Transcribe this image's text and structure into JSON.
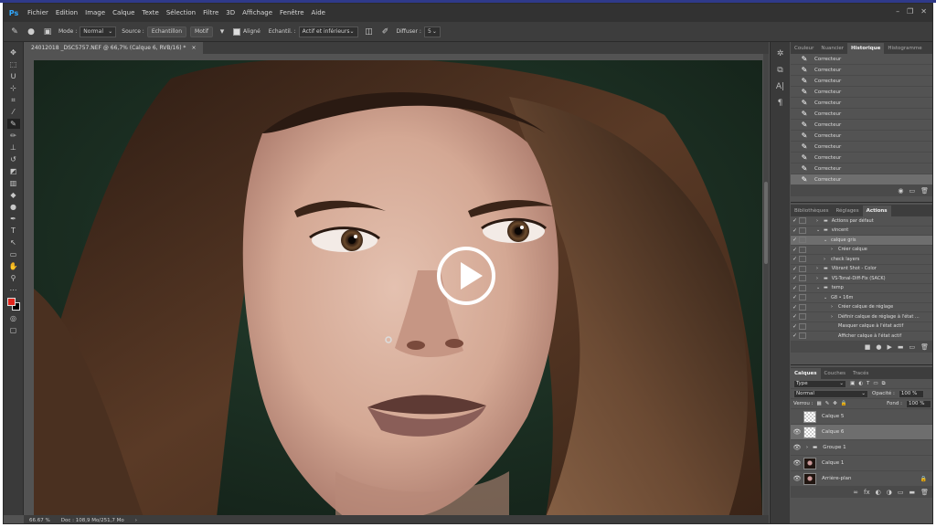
{
  "menubar": {
    "logo": "Ps",
    "items": [
      "Fichier",
      "Edition",
      "Image",
      "Calque",
      "Texte",
      "Sélection",
      "Filtre",
      "3D",
      "Affichage",
      "Fenêtre",
      "Aide"
    ],
    "window_controls": [
      "–",
      "❐",
      "✕"
    ]
  },
  "options": {
    "mode_label": "Mode :",
    "mode_value": "Normal",
    "source_label": "Source :",
    "sample_btn": "Echantillon",
    "pattern_btn": "Motif",
    "aligned_label": "Aligné",
    "sample_label": "Echantil. :",
    "sample_value": "Actif et inférieurs",
    "diffuse_label": "Diffuser :",
    "diffuse_value": "5"
  },
  "document": {
    "tab_title": "24012018 _DSC5757.NEF @ 66,7% (Calque 6, RVB/16) *",
    "tab_close": "×"
  },
  "status": {
    "zoom": "66.67 %",
    "doc_info": "Doc : 108,9 Mo/251,7 Mo"
  },
  "history_panel": {
    "tabs": [
      "Couleur",
      "Nuancier",
      "Historique",
      "Histogramme"
    ],
    "active_tab": "Historique",
    "entries": [
      "Correcteur",
      "Correcteur",
      "Correcteur",
      "Correcteur",
      "Correcteur",
      "Correcteur",
      "Correcteur",
      "Correcteur",
      "Correcteur",
      "Correcteur",
      "Correcteur",
      "Correcteur"
    ],
    "selected_index": 11
  },
  "actions_panel": {
    "tabs": [
      "Bibliothèques",
      "Réglages",
      "Actions"
    ],
    "active_tab": "Actions",
    "rows": [
      {
        "indent": 1,
        "arrow": "›",
        "folder": true,
        "label": "Actions par défaut",
        "sel": false
      },
      {
        "indent": 1,
        "arrow": "⌄",
        "folder": true,
        "label": "vincent",
        "sel": false
      },
      {
        "indent": 2,
        "arrow": "⌄",
        "folder": false,
        "label": "calque gris",
        "sel": true
      },
      {
        "indent": 3,
        "arrow": "›",
        "folder": false,
        "label": "Créer calque",
        "sel": false
      },
      {
        "indent": 2,
        "arrow": "›",
        "folder": false,
        "label": "check layers",
        "sel": false
      },
      {
        "indent": 1,
        "arrow": "›",
        "folder": true,
        "label": "Vibrant Shot - Color",
        "sel": false
      },
      {
        "indent": 1,
        "arrow": "›",
        "folder": true,
        "label": "VS-Tonal-Diff-Fix (SACK)",
        "sel": false
      },
      {
        "indent": 1,
        "arrow": "⌄",
        "folder": true,
        "label": "temp",
        "sel": false
      },
      {
        "indent": 2,
        "arrow": "⌄",
        "folder": false,
        "label": "G8 • 16m",
        "sel": false
      },
      {
        "indent": 3,
        "arrow": "›",
        "folder": false,
        "label": "Créer calque de réglage",
        "sel": false
      },
      {
        "indent": 3,
        "arrow": "›",
        "folder": false,
        "label": "Définir calque de réglage à l'état ...",
        "sel": false
      },
      {
        "indent": 3,
        "arrow": "",
        "folder": false,
        "label": "Masquer calque à l'état actif",
        "sel": false
      },
      {
        "indent": 3,
        "arrow": "",
        "folder": false,
        "label": "Afficher calque à l'état actif",
        "sel": false
      }
    ],
    "footer_icons": [
      "■",
      "●",
      "▶",
      "▬",
      "▭",
      "🗑"
    ]
  },
  "layers_panel": {
    "tabs": [
      "Calques",
      "Couches",
      "Tracés"
    ],
    "active_tab": "Calques",
    "filter_value": "Type",
    "blend_mode": "Normal",
    "opacity_label": "Opacité :",
    "opacity_value": "100 %",
    "lock_label": "Verrou :",
    "fill_label": "Fond :",
    "fill_value": "100 %",
    "layers": [
      {
        "name": "Calque 5",
        "visible": false,
        "thumb": "check",
        "sel": false
      },
      {
        "name": "Calque 6",
        "visible": true,
        "thumb": "check",
        "sel": true
      },
      {
        "name": "Groupe 1",
        "visible": true,
        "thumb": "folder",
        "sel": false
      },
      {
        "name": "Calque 1",
        "visible": true,
        "thumb": "face",
        "sel": false
      },
      {
        "name": "Arrière-plan",
        "visible": true,
        "thumb": "face",
        "sel": false
      }
    ],
    "footer_icons": [
      "∞",
      "fx",
      "◐",
      "◑",
      "▭",
      "▬",
      "🗑"
    ]
  },
  "colors": {
    "foreground": "#e0261d",
    "background": "#000000",
    "canvas_bg": "#1d3326"
  }
}
